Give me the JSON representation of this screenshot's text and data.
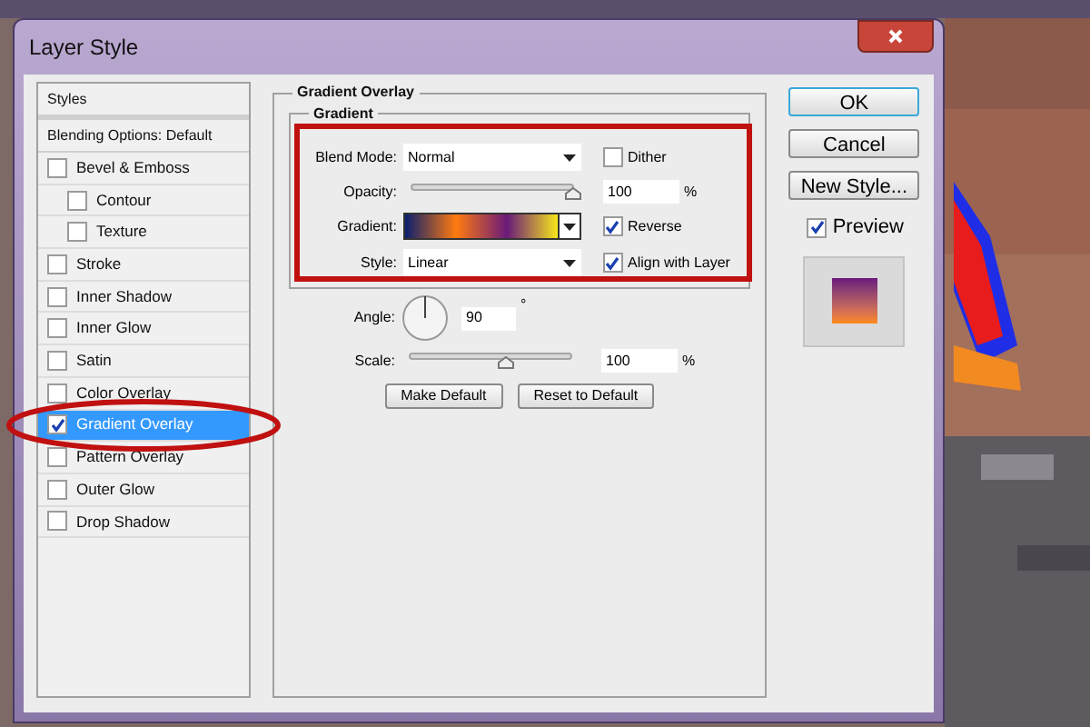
{
  "window": {
    "title": "Layer Style"
  },
  "sidebar": {
    "header": "Styles",
    "blending": "Blending Options: Default",
    "items": [
      {
        "label": "Bevel & Emboss",
        "checked": false,
        "selected": false,
        "children": [
          {
            "label": "Contour",
            "checked": false,
            "selected": false
          },
          {
            "label": "Texture",
            "checked": false,
            "selected": false
          }
        ]
      },
      {
        "label": "Stroke",
        "checked": false,
        "selected": false
      },
      {
        "label": "Inner Shadow",
        "checked": false,
        "selected": false
      },
      {
        "label": "Inner Glow",
        "checked": false,
        "selected": false
      },
      {
        "label": "Satin",
        "checked": false,
        "selected": false
      },
      {
        "label": "Color Overlay",
        "checked": false,
        "selected": false
      },
      {
        "label": "Gradient Overlay",
        "checked": true,
        "selected": true
      },
      {
        "label": "Pattern Overlay",
        "checked": false,
        "selected": false
      },
      {
        "label": "Outer Glow",
        "checked": false,
        "selected": false
      },
      {
        "label": "Drop Shadow",
        "checked": false,
        "selected": false
      }
    ]
  },
  "panel": {
    "title": "Gradient Overlay",
    "group": "Gradient",
    "blend_mode": {
      "label": "Blend Mode:",
      "value": "Normal"
    },
    "dither": {
      "label": "Dither",
      "checked": false
    },
    "opacity": {
      "label": "Opacity:",
      "level": 1,
      "value": "100",
      "unit": "%"
    },
    "gradient": {
      "label": "Gradient:"
    },
    "reverse": {
      "label": "Reverse",
      "checked": true
    },
    "style": {
      "label": "Style:",
      "value": "Linear"
    },
    "align": {
      "label": "Align with Layer",
      "checked": true
    },
    "angle": {
      "label": "Angle:",
      "value": "90",
      "unit": "°"
    },
    "scale": {
      "label": "Scale:",
      "level": 0.6,
      "value": "100",
      "unit": "%"
    },
    "buttons": [
      "Make Default",
      "Reset to Default"
    ]
  },
  "actions": {
    "buttons": [
      "OK",
      "Cancel",
      "New Style..."
    ],
    "preview": {
      "label": "Preview",
      "checked": true
    }
  }
}
